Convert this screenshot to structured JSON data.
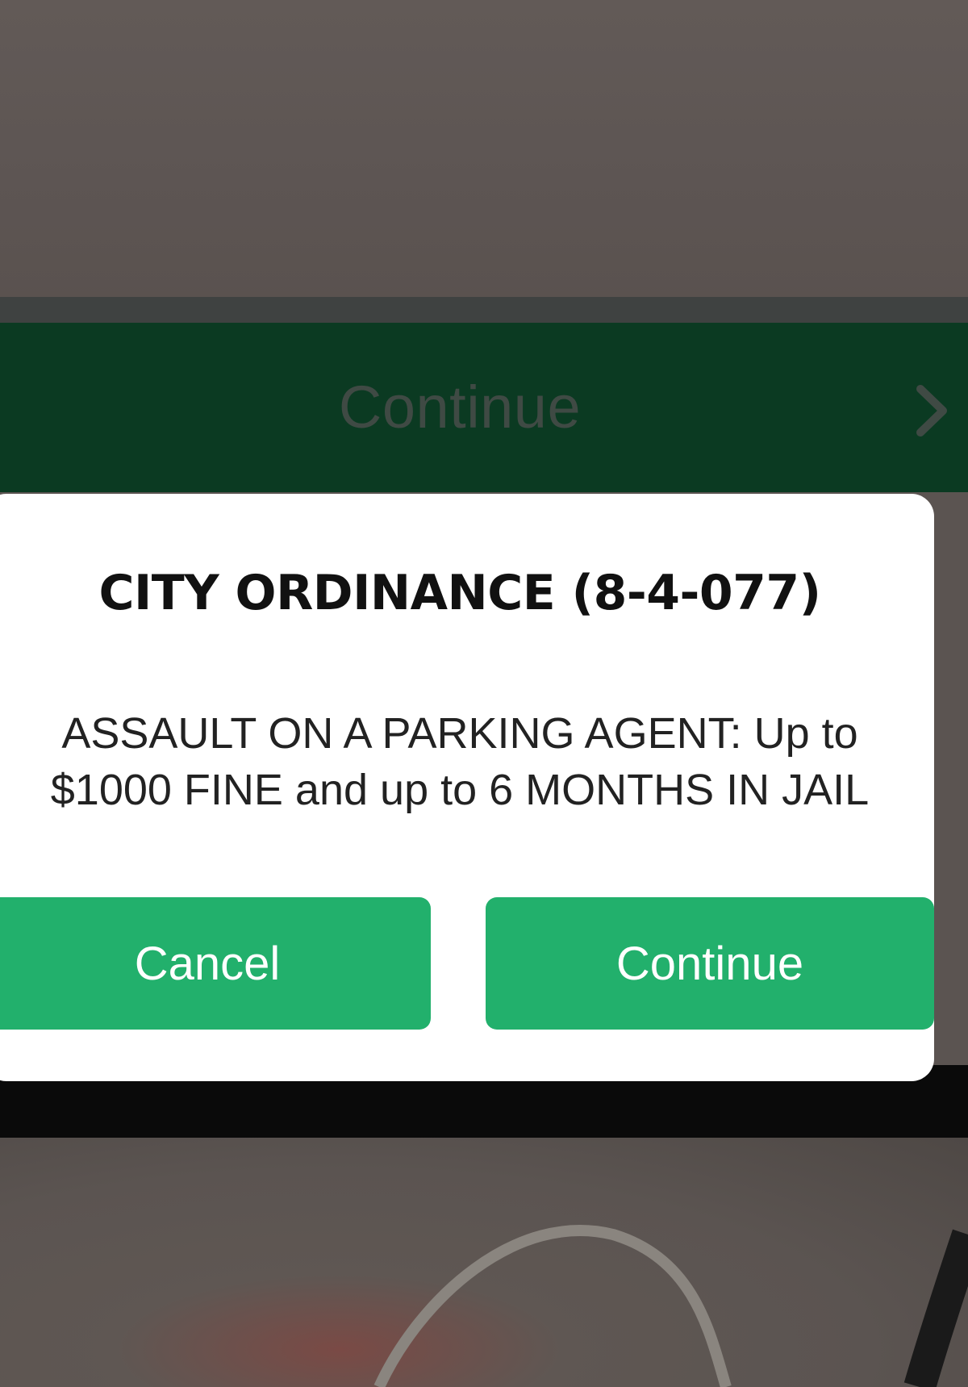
{
  "background": {
    "continue_bar_label": "Continue",
    "chevron_icon": "chevron-right-icon"
  },
  "dialog": {
    "title": "CITY ORDINANCE (8-4-077)",
    "message_line1": "ASSAULT ON A PARKING AGENT: Up to",
    "message_line2": "$1000 FINE and up to 6 MONTHS IN JAIL",
    "cancel_label": "Cancel",
    "continue_label": "Continue"
  },
  "colors": {
    "button_green": "#22b06c",
    "bar_dark_green": "#0b3a22",
    "dialog_bg": "#ffffff"
  }
}
